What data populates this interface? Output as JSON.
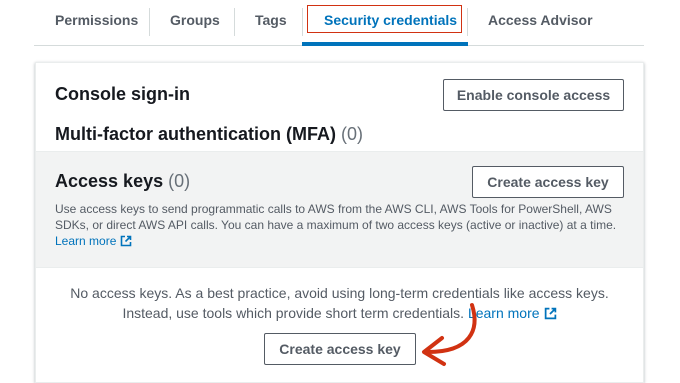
{
  "tabs": [
    {
      "label": "Permissions"
    },
    {
      "label": "Groups"
    },
    {
      "label": "Tags"
    },
    {
      "label": "Security credentials"
    },
    {
      "label": "Access Advisor"
    }
  ],
  "console": {
    "title": "Console sign-in",
    "enable_button": "Enable console access"
  },
  "mfa": {
    "title": "Multi-factor authentication (MFA)",
    "count": "(0)"
  },
  "access_keys": {
    "title": "Access keys",
    "count": "(0)",
    "create_button": "Create access key",
    "description": "Use access keys to send programmatic calls to AWS from the AWS CLI, AWS Tools for PowerShell, AWS SDKs, or direct AWS API calls. You can have a maximum of two access keys (active or inactive) at a time.",
    "learn_more": "Learn more"
  },
  "empty_state": {
    "message": "No access keys. As a best practice, avoid using long-term credentials like access keys. Instead, use tools which provide short term credentials.",
    "learn_more": "Learn more",
    "create_button": "Create access key"
  },
  "colors": {
    "accent": "#0073bb",
    "annotation": "#d13212"
  },
  "icons": {
    "external": "external-link-icon",
    "annotation": "red-arrow-annotation"
  }
}
